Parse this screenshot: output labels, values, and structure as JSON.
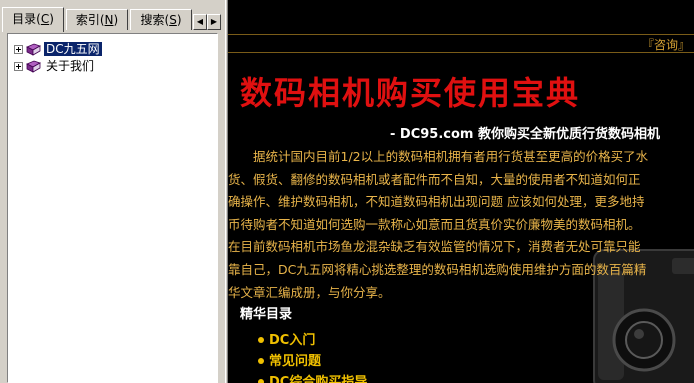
{
  "nav": {
    "tabs": [
      {
        "label": "目录(C)",
        "text": "目录",
        "key": "C"
      },
      {
        "label": "索引(N)",
        "text": "索引",
        "key": "N"
      },
      {
        "label": "搜索(S)",
        "text": "搜索",
        "key": "S"
      }
    ],
    "scroll_left": "◀",
    "scroll_right": "▶",
    "tree": [
      {
        "label": "DC九五网",
        "selected": true,
        "icon": "book-icon"
      },
      {
        "label": "关于我们",
        "selected": false,
        "icon": "book-icon"
      }
    ]
  },
  "content": {
    "consult_link": "『咨询』",
    "title": "数码相机购买使用宝典",
    "subtitle": "- DC95.com 教你购买全新优质行货数码相机",
    "paragraphs": [
      "　　据统计国内目前1/2以上的数码相机拥有者用行货甚至更高的价格买了水",
      "货、假货、翻修的数码相机或者配件而不自知，大量的使用者不知道如何正",
      "确操作、维护数码相机，不知道数码相机出现问题 应该如何处理，更多地持",
      "币待购者不知道如何选购一款称心如意而且货真价实价廉物美的数码相机。",
      "在目前数码相机市场鱼龙混杂缺乏有效监管的情况下，消费者无处可靠只能",
      "靠自己，DC九五网将精心挑选整理的数码相机选购使用维护方面的数百篇精",
      "华文章汇编成册，与你分享。"
    ],
    "section_title": "精华目录",
    "toc": [
      "DC入门",
      "常见问题",
      "DC综合购买指导"
    ]
  },
  "colors": {
    "title_red": "#e01010",
    "body_gold": "#e8b44a",
    "toc_yellow": "#f0c000",
    "selection_blue": "#0a246a"
  }
}
